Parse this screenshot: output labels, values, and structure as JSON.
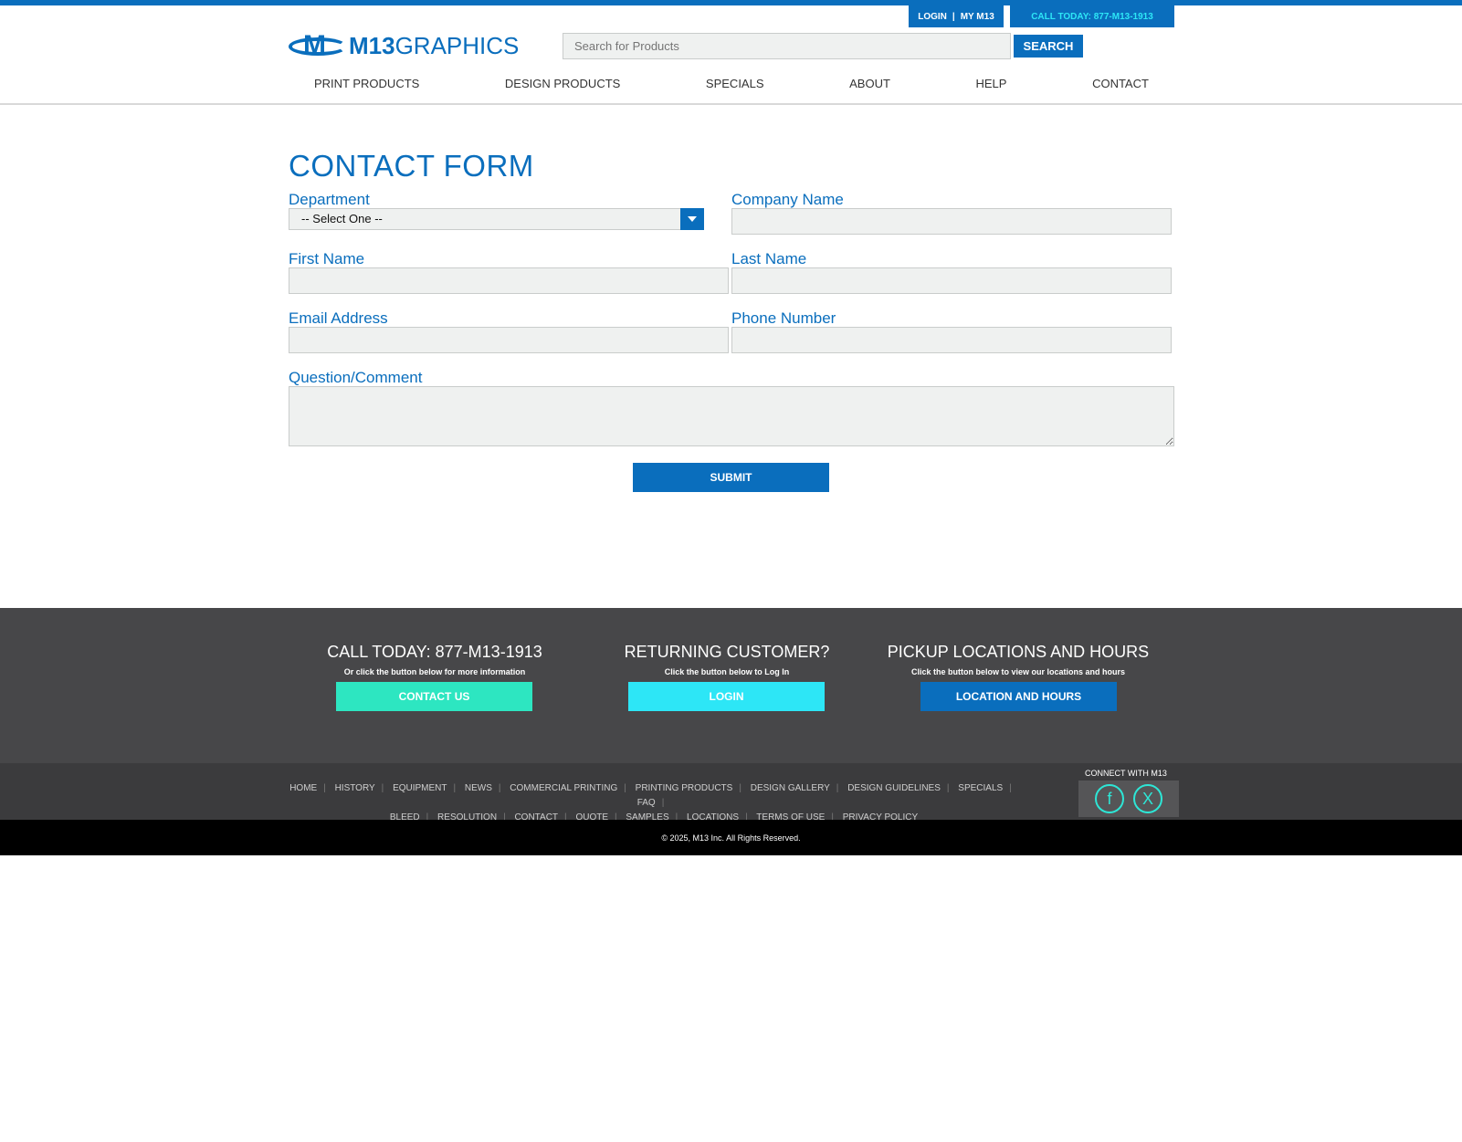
{
  "util": {
    "login": "LOGIN",
    "sep": "|",
    "my": "MY M13",
    "call": "CALL TODAY: 877-M13-1913"
  },
  "logo": {
    "mark": "M",
    "bold": "M13",
    "rest": "GRAPHICS"
  },
  "search": {
    "placeholder": "Search for Products",
    "button": "SEARCH"
  },
  "nav": [
    "PRINT PRODUCTS",
    "DESIGN PRODUCTS",
    "SPECIALS",
    "ABOUT",
    "HELP",
    "CONTACT"
  ],
  "form": {
    "title": "CONTACT FORM",
    "department_label": "Department",
    "department_value": "-- Select One --",
    "company_label": "Company Name",
    "first_label": "First Name",
    "last_label": "Last Name",
    "email_label": "Email Address",
    "phone_label": "Phone Number",
    "comment_label": "Question/Comment",
    "submit": "SUBMIT"
  },
  "footer": {
    "col1": {
      "title": "CALL TODAY: 877-M13-1913",
      "sub": "Or click the button below for more information",
      "button": "CONTACT US"
    },
    "col2": {
      "title": "RETURNING CUSTOMER?",
      "sub": "Click the button below to Log In",
      "button": "LOGIN"
    },
    "col3": {
      "title": "PICKUP LOCATIONS AND HOURS",
      "sub": "Click the button below to view our locations and hours",
      "button": "LOCATION AND HOURS"
    },
    "links_row1": [
      "HOME",
      "HISTORY",
      "EQUIPMENT",
      "NEWS",
      "COMMERCIAL PRINTING",
      "PRINTING PRODUCTS",
      "DESIGN GALLERY",
      "DESIGN GUIDELINES",
      "SPECIALS",
      "FAQ"
    ],
    "links_row2": [
      "BLEED",
      "RESOLUTION",
      "CONTACT",
      "QUOTE",
      "SAMPLES",
      "LOCATIONS",
      "TERMS OF USE",
      "PRIVACY POLICY"
    ],
    "connect": "CONNECT WITH M13",
    "copyright": "© 2025, M13 Inc. All Rights Reserved."
  },
  "colors": {
    "brand": "#0a6ebd",
    "teal": "#2de6c1",
    "cyan": "#2de6f6"
  }
}
